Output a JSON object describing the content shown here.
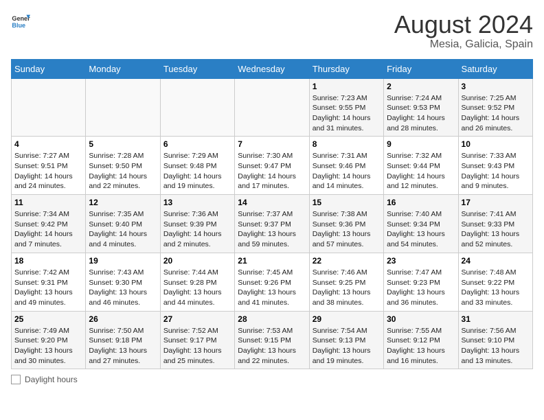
{
  "header": {
    "logo_general": "General",
    "logo_blue": "Blue",
    "month_year": "August 2024",
    "location": "Mesia, Galicia, Spain"
  },
  "weekdays": [
    "Sunday",
    "Monday",
    "Tuesday",
    "Wednesday",
    "Thursday",
    "Friday",
    "Saturday"
  ],
  "weeks": [
    [
      {
        "day": "",
        "info": ""
      },
      {
        "day": "",
        "info": ""
      },
      {
        "day": "",
        "info": ""
      },
      {
        "day": "",
        "info": ""
      },
      {
        "day": "1",
        "info": "Sunrise: 7:23 AM\nSunset: 9:55 PM\nDaylight: 14 hours and 31 minutes."
      },
      {
        "day": "2",
        "info": "Sunrise: 7:24 AM\nSunset: 9:53 PM\nDaylight: 14 hours and 28 minutes."
      },
      {
        "day": "3",
        "info": "Sunrise: 7:25 AM\nSunset: 9:52 PM\nDaylight: 14 hours and 26 minutes."
      }
    ],
    [
      {
        "day": "4",
        "info": "Sunrise: 7:27 AM\nSunset: 9:51 PM\nDaylight: 14 hours and 24 minutes."
      },
      {
        "day": "5",
        "info": "Sunrise: 7:28 AM\nSunset: 9:50 PM\nDaylight: 14 hours and 22 minutes."
      },
      {
        "day": "6",
        "info": "Sunrise: 7:29 AM\nSunset: 9:48 PM\nDaylight: 14 hours and 19 minutes."
      },
      {
        "day": "7",
        "info": "Sunrise: 7:30 AM\nSunset: 9:47 PM\nDaylight: 14 hours and 17 minutes."
      },
      {
        "day": "8",
        "info": "Sunrise: 7:31 AM\nSunset: 9:46 PM\nDaylight: 14 hours and 14 minutes."
      },
      {
        "day": "9",
        "info": "Sunrise: 7:32 AM\nSunset: 9:44 PM\nDaylight: 14 hours and 12 minutes."
      },
      {
        "day": "10",
        "info": "Sunrise: 7:33 AM\nSunset: 9:43 PM\nDaylight: 14 hours and 9 minutes."
      }
    ],
    [
      {
        "day": "11",
        "info": "Sunrise: 7:34 AM\nSunset: 9:42 PM\nDaylight: 14 hours and 7 minutes."
      },
      {
        "day": "12",
        "info": "Sunrise: 7:35 AM\nSunset: 9:40 PM\nDaylight: 14 hours and 4 minutes."
      },
      {
        "day": "13",
        "info": "Sunrise: 7:36 AM\nSunset: 9:39 PM\nDaylight: 14 hours and 2 minutes."
      },
      {
        "day": "14",
        "info": "Sunrise: 7:37 AM\nSunset: 9:37 PM\nDaylight: 13 hours and 59 minutes."
      },
      {
        "day": "15",
        "info": "Sunrise: 7:38 AM\nSunset: 9:36 PM\nDaylight: 13 hours and 57 minutes."
      },
      {
        "day": "16",
        "info": "Sunrise: 7:40 AM\nSunset: 9:34 PM\nDaylight: 13 hours and 54 minutes."
      },
      {
        "day": "17",
        "info": "Sunrise: 7:41 AM\nSunset: 9:33 PM\nDaylight: 13 hours and 52 minutes."
      }
    ],
    [
      {
        "day": "18",
        "info": "Sunrise: 7:42 AM\nSunset: 9:31 PM\nDaylight: 13 hours and 49 minutes."
      },
      {
        "day": "19",
        "info": "Sunrise: 7:43 AM\nSunset: 9:30 PM\nDaylight: 13 hours and 46 minutes."
      },
      {
        "day": "20",
        "info": "Sunrise: 7:44 AM\nSunset: 9:28 PM\nDaylight: 13 hours and 44 minutes."
      },
      {
        "day": "21",
        "info": "Sunrise: 7:45 AM\nSunset: 9:26 PM\nDaylight: 13 hours and 41 minutes."
      },
      {
        "day": "22",
        "info": "Sunrise: 7:46 AM\nSunset: 9:25 PM\nDaylight: 13 hours and 38 minutes."
      },
      {
        "day": "23",
        "info": "Sunrise: 7:47 AM\nSunset: 9:23 PM\nDaylight: 13 hours and 36 minutes."
      },
      {
        "day": "24",
        "info": "Sunrise: 7:48 AM\nSunset: 9:22 PM\nDaylight: 13 hours and 33 minutes."
      }
    ],
    [
      {
        "day": "25",
        "info": "Sunrise: 7:49 AM\nSunset: 9:20 PM\nDaylight: 13 hours and 30 minutes."
      },
      {
        "day": "26",
        "info": "Sunrise: 7:50 AM\nSunset: 9:18 PM\nDaylight: 13 hours and 27 minutes."
      },
      {
        "day": "27",
        "info": "Sunrise: 7:52 AM\nSunset: 9:17 PM\nDaylight: 13 hours and 25 minutes."
      },
      {
        "day": "28",
        "info": "Sunrise: 7:53 AM\nSunset: 9:15 PM\nDaylight: 13 hours and 22 minutes."
      },
      {
        "day": "29",
        "info": "Sunrise: 7:54 AM\nSunset: 9:13 PM\nDaylight: 13 hours and 19 minutes."
      },
      {
        "day": "30",
        "info": "Sunrise: 7:55 AM\nSunset: 9:12 PM\nDaylight: 13 hours and 16 minutes."
      },
      {
        "day": "31",
        "info": "Sunrise: 7:56 AM\nSunset: 9:10 PM\nDaylight: 13 hours and 13 minutes."
      }
    ]
  ],
  "footer": {
    "daylight_label": "Daylight hours"
  }
}
